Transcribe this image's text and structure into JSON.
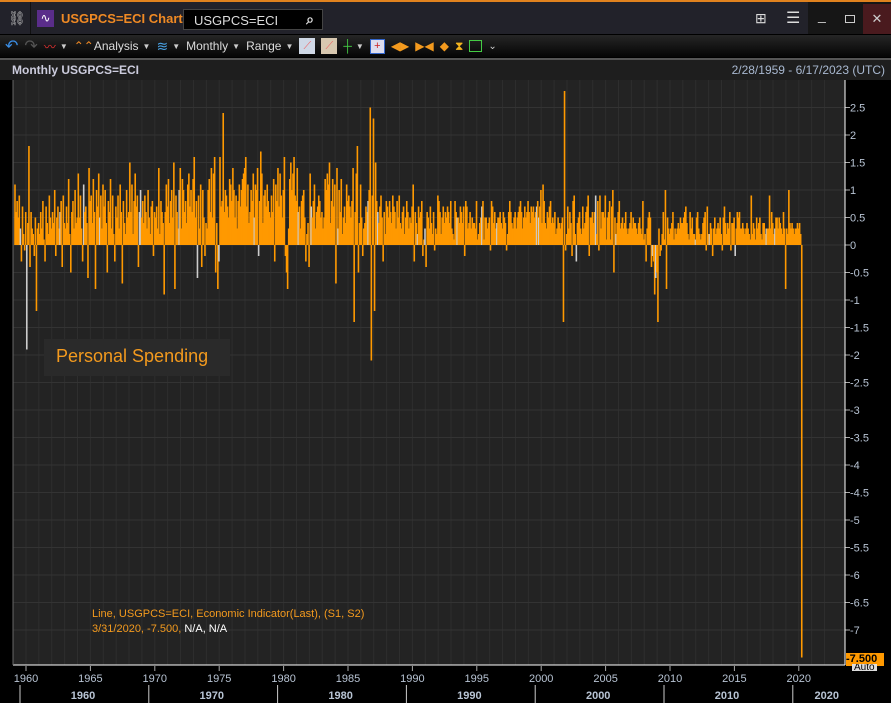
{
  "window": {
    "title": "USGPCS=ECI Chart",
    "search_value": "USGPCS=ECI",
    "accent": "#f08a24"
  },
  "toolbar": {
    "analysis": "Analysis",
    "period": "Monthly",
    "range": "Range"
  },
  "header": {
    "title": "Monthly USGPCS=ECI",
    "date_range": "2/28/1959 - 6/17/2023 (UTC)"
  },
  "annotation": "Personal Spending",
  "legend": {
    "line1": "Line, USGPCS=ECI, Economic Indicator(Last), (S1, S2)",
    "line2_date": "3/31/2020, -7.500,",
    "line2_rest": " N/A, N/A"
  },
  "last_value": {
    "label": "-7.500",
    "mode": "Auto"
  },
  "chart_data": {
    "type": "bar",
    "frequency": "monthly",
    "start": "1959-02",
    "end": "2020-03",
    "series_color": "#ff9900",
    "ylim": [
      -7.5,
      2.8
    ],
    "yticks": [
      "2.5",
      "2",
      "1.5",
      "1",
      "0.5",
      "0",
      "-0.5",
      "-1",
      "-1.5",
      "-2",
      "-2.5",
      "-3",
      "-3.5",
      "-4",
      "-4.5",
      "-5",
      "-5.5",
      "-6",
      "-6.5",
      "-7"
    ],
    "xticks": [
      "1960",
      "1965",
      "1970",
      "1975",
      "1980",
      "1985",
      "1990",
      "1995",
      "2000",
      "2005",
      "2010",
      "2015",
      "2020"
    ],
    "decades": [
      "1960",
      "1970",
      "1980",
      "1990",
      "2000",
      "2010",
      "2020"
    ],
    "grid": true,
    "values": [
      1.1,
      0.6,
      0.8,
      0.5,
      0.9,
      0.3,
      -0.3,
      0.7,
      0.2,
      -0.1,
      0.6,
      -1.9,
      0.4,
      1.8,
      -0.4,
      0.6,
      0.3,
      0.2,
      -0.2,
      0.5,
      -1.2,
      0.3,
      0.4,
      0.2,
      0.6,
      0.3,
      0.8,
      0.1,
      -0.3,
      0.7,
      0.4,
      0.2,
      0.9,
      0.5,
      0.3,
      0.6,
      0.4,
      1.0,
      -0.2,
      0.5,
      0.7,
      0.3,
      0.6,
      0.8,
      -0.4,
      0.9,
      0.4,
      0.3,
      0.7,
      0.4,
      1.2,
      0.2,
      -0.5,
      0.6,
      0.8,
      0.3,
      1.0,
      0.4,
      0.5,
      1.3,
      0.5,
      0.9,
      0.3,
      -0.3,
      1.1,
      0.6,
      0.7,
      0.4,
      -0.6,
      1.4,
      0.8,
      0.9,
      0.4,
      1.2,
      0.6,
      -0.8,
      1.0,
      0.7,
      1.3,
      0.5,
      0.9,
      0.3,
      1.1,
      0.7,
      1.0,
      0.4,
      -0.5,
      0.8,
      0.6,
      1.2,
      0.3,
      0.9,
      0.2,
      -0.3,
      0.7,
      0.5,
      0.9,
      0.3,
      1.1,
      0.6,
      -0.7,
      0.8,
      0.4,
      0.2,
      1.0,
      0.5,
      0.6,
      1.5,
      0.6,
      1.1,
      0.2,
      0.8,
      1.3,
      0.7,
      0.9,
      -0.4,
      0.6,
      1.0,
      0.5,
      0.8,
      0.4,
      0.9,
      0.6,
      0.3,
      1.0,
      0.5,
      0.2,
      0.7,
      0.8,
      -0.2,
      0.6,
      0.5,
      0.7,
      0.3,
      1.4,
      0.2,
      0.8,
      0.6,
      0.4,
      -0.9,
      0.6,
      1.1,
      0.7,
      1.2,
      0.4,
      0.8,
      1.0,
      0.5,
      1.5,
      -0.8,
      0.9,
      0.6,
      0.3,
      1.0,
      1.4,
      0.3,
      1.2,
      1.0,
      0.6,
      0.8,
      0.4,
      1.1,
      1.3,
      0.7,
      1.0,
      0.6,
      1.2,
      1.6,
      0.5,
      0.8,
      -0.6,
      0.9,
      0.3,
      1.1,
      -0.4,
      1.0,
      0.5,
      -0.2,
      0.4,
      0.3,
      1.0,
      1.2,
      0.6,
      1.4,
      0.5,
      1.3,
      1.6,
      -0.5,
      0.4,
      -0.8,
      -0.3,
      1.6,
      0.7,
      0.8,
      2.4,
      0.6,
      1.0,
      0.9,
      0.7,
      0.5,
      1.2,
      1.1,
      0.8,
      1.4,
      1.0,
      0.5,
      0.9,
      0.3,
      0.8,
      1.1,
      0.7,
      1.0,
      1.2,
      1.3,
      1.4,
      1.6,
      0.7,
      1.1,
      0.4,
      0.6,
      1.0,
      0.8,
      1.3,
      0.5,
      1.1,
      1.0,
      1.4,
      -0.2,
      0.8,
      1.7,
      1.3,
      0.4,
      0.9,
      1.0,
      0.7,
      1.1,
      0.8,
      0.6,
      0.5,
      0.9,
      0.6,
      1.2,
      -0.3,
      1.1,
      0.8,
      1.4,
      0.7,
      1.3,
      0.9,
      0.5,
      1.0,
      1.6,
      -0.2,
      -0.5,
      -0.8,
      0.3,
      1.2,
      1.5,
      1.0,
      1.3,
      1.6,
      0.9,
      0.8,
      1.4,
      0.6,
      0.7,
      0.3,
      0.8,
      0.9,
      1.0,
      0.5,
      -0.3,
      0.2,
      0.4,
      -0.4,
      1.3,
      0.7,
      0.5,
      0.8,
      1.1,
      0.3,
      0.6,
      0.7,
      0.9,
      0.8,
      0.5,
      0.6,
      0.3,
      0.5,
      1.2,
      1.0,
      1.3,
      1.1,
      1.5,
      0.4,
      0.8,
      1.2,
      0.7,
      1.1,
      -0.7,
      1.4,
      0.3,
      1.0,
      0.6,
      1.2,
      0.2,
      0.5,
      0.7,
      0.4,
      1.1,
      0.8,
      0.9,
      0.7,
      0.5,
      0.8,
      1.4,
      -1.4,
      0.6,
      1.3,
      1.8,
      -0.5,
      0.4,
      1.1,
      0.5,
      -0.2,
      0.3,
      0.4,
      0.7,
      0.6,
      0.8,
      1.0,
      2.5,
      -2.1,
      0.9,
      2.3,
      -1.2,
      1.5,
      0.8,
      0.6,
      0.4,
      0.7,
      0.9,
      0.5,
      -0.3,
      0.6,
      0.2,
      0.8,
      0.7,
      0.5,
      0.8,
      0.6,
      0.4,
      0.9,
      0.7,
      0.6,
      0.3,
      0.8,
      0.5,
      0.9,
      0.4,
      0.3,
      0.6,
      0.7,
      0.2,
      0.5,
      0.8,
      0.6,
      0.3,
      0.5,
      0.4,
      0.7,
      1.1,
      -0.3,
      0.6,
      0.4,
      0.2,
      0.7,
      0.5,
      0.6,
      0.8,
      -0.2,
      0.1,
      0.3,
      -0.4,
      0.6,
      0.5,
      0.3,
      0.7,
      0.4,
      0.2,
      0.6,
      -0.1,
      0.3,
      0.2,
      0.9,
      0.8,
      0.6,
      0.2,
      0.5,
      0.7,
      0.4,
      0.6,
      0.5,
      0.7,
      0.6,
      0.4,
      0.8,
      0.3,
      0.2,
      0.1,
      0.8,
      0.6,
      0.5,
      0.5,
      0.4,
      0.7,
      0.6,
      0.4,
      0.7,
      -0.2,
      0.8,
      0.7,
      0.3,
      0.4,
      0.6,
      0.3,
      0.5,
      0.4,
      0.4,
      0.3,
      0.8,
      0.1,
      0.2,
      0.4,
      0.5,
      0.7,
      0.8,
      0.1,
      0.5,
      0.5,
      0.3,
      0.4,
      0.5,
      -0.1,
      0.8,
      0.7,
      0.4,
      0.6,
      0.3,
      0.4,
      0.5,
      0.5,
      0.6,
      0.4,
      0.3,
      0.6,
      0.5,
      0.4,
      -0.1,
      0.2,
      0.6,
      0.8,
      0.6,
      0.4,
      0.3,
      0.5,
      0.6,
      0.3,
      0.5,
      0.6,
      0.7,
      0.8,
      0.6,
      0.3,
      0.5,
      0.7,
      0.5,
      0.6,
      0.8,
      0.6,
      0.4,
      0.7,
      0.6,
      0.7,
      0.5,
      0.6,
      0.7,
      0.8,
      0.5,
      0.7,
      1.0,
      0.4,
      1.1,
      0.8,
      0.4,
      0.3,
      0.6,
      0.5,
      0.7,
      0.8,
      0.4,
      0.5,
      0.4,
      0.6,
      0.2,
      0.3,
      0.5,
      0.4,
      0.3,
      0.4,
      0.5,
      -1.4,
      2.8,
      -0.1,
      0.2,
      0.7,
      0.3,
      0.6,
      0.4,
      -0.2,
      0.8,
      0.9,
      0.2,
      -0.3,
      0.4,
      0.5,
      0.6,
      0.3,
      0.2,
      0.7,
      0.3,
      0.4,
      0.6,
      0.7,
      0.9,
      -0.2,
      0.5,
      0.5,
      0.6,
      0.4,
      0.6,
      0.9,
      0.2,
      0.8,
      -0.1,
      0.9,
      0.3,
      0.6,
      0.6,
      0.5,
      0.9,
      0.1,
      0.5,
      0.6,
      0.8,
      0.1,
      0.7,
      1.0,
      -0.5,
      0.5,
      0.2,
      0.4,
      0.6,
      0.8,
      0.3,
      0.4,
      0.5,
      0.3,
      0.4,
      0.6,
      0.3,
      0.2,
      0.3,
      0.4,
      0.6,
      0.3,
      0.5,
      0.4,
      0.4,
      0.3,
      0.2,
      0.4,
      0.5,
      0.3,
      0.2,
      0.8,
      0.1,
      0.2,
      -0.3,
      0.3,
      0.5,
      0.6,
      0.5,
      -0.4,
      -0.2,
      -0.3,
      -0.9,
      -0.6,
      -0.5,
      -1.4,
      0.3,
      -0.2,
      -0.1,
      0.2,
      0.6,
      0.1,
      1.0,
      -0.8,
      0.5,
      0.3,
      0.2,
      0.3,
      0.4,
      0.6,
      0.1,
      0.3,
      0.2,
      0.3,
      0.4,
      0.3,
      0.5,
      0.4,
      0.4,
      0.5,
      0.6,
      0.7,
      0.4,
      0.2,
      0.1,
      0.6,
      0.3,
      0.5,
      0.2,
      0.2,
      0.1,
      0.5,
      0.6,
      0.3,
      0.2,
      0.1,
      0.2,
      0.4,
      0.5,
      0.6,
      -0.1,
      0.7,
      0.2,
      0.2,
      0.4,
      0.3,
      -0.2,
      0.3,
      0.5,
      0.2,
      0.3,
      0.4,
      0.3,
      0.5,
      0.2,
      -0.1,
      0.5,
      0.7,
      0.4,
      0.2,
      0.4,
      0.3,
      0.6,
      -0.1,
      0.4,
      0.4,
      0.5,
      -0.2,
      0.3,
      0.6,
      0.5,
      0.6,
      0.3,
      0.3,
      0.4,
      0.3,
      0.2,
      0.3,
      0.4,
      0.3,
      0.2,
      0.1,
      0.9,
      0.2,
      0.4,
      0.3,
      0.1,
      0.5,
      0.3,
      0.4,
      0.5,
      0.2,
      0.1,
      0.4,
      0.4,
      0.2,
      0.3,
      0.3,
      0.3,
      0.9,
      0.3,
      0.6,
      0.4,
      0.2,
      0.3,
      0.5,
      0.5,
      0.3,
      0.5,
      0.4,
      0.3,
      0.2,
      0.6,
      0.3,
      -0.8,
      0.3,
      0.2,
      1.0,
      0.4,
      0.3,
      0.4,
      0.3,
      0.2,
      0.3,
      0.3,
      0.4,
      0.3,
      0.4,
      0.2,
      -7.5
    ]
  }
}
